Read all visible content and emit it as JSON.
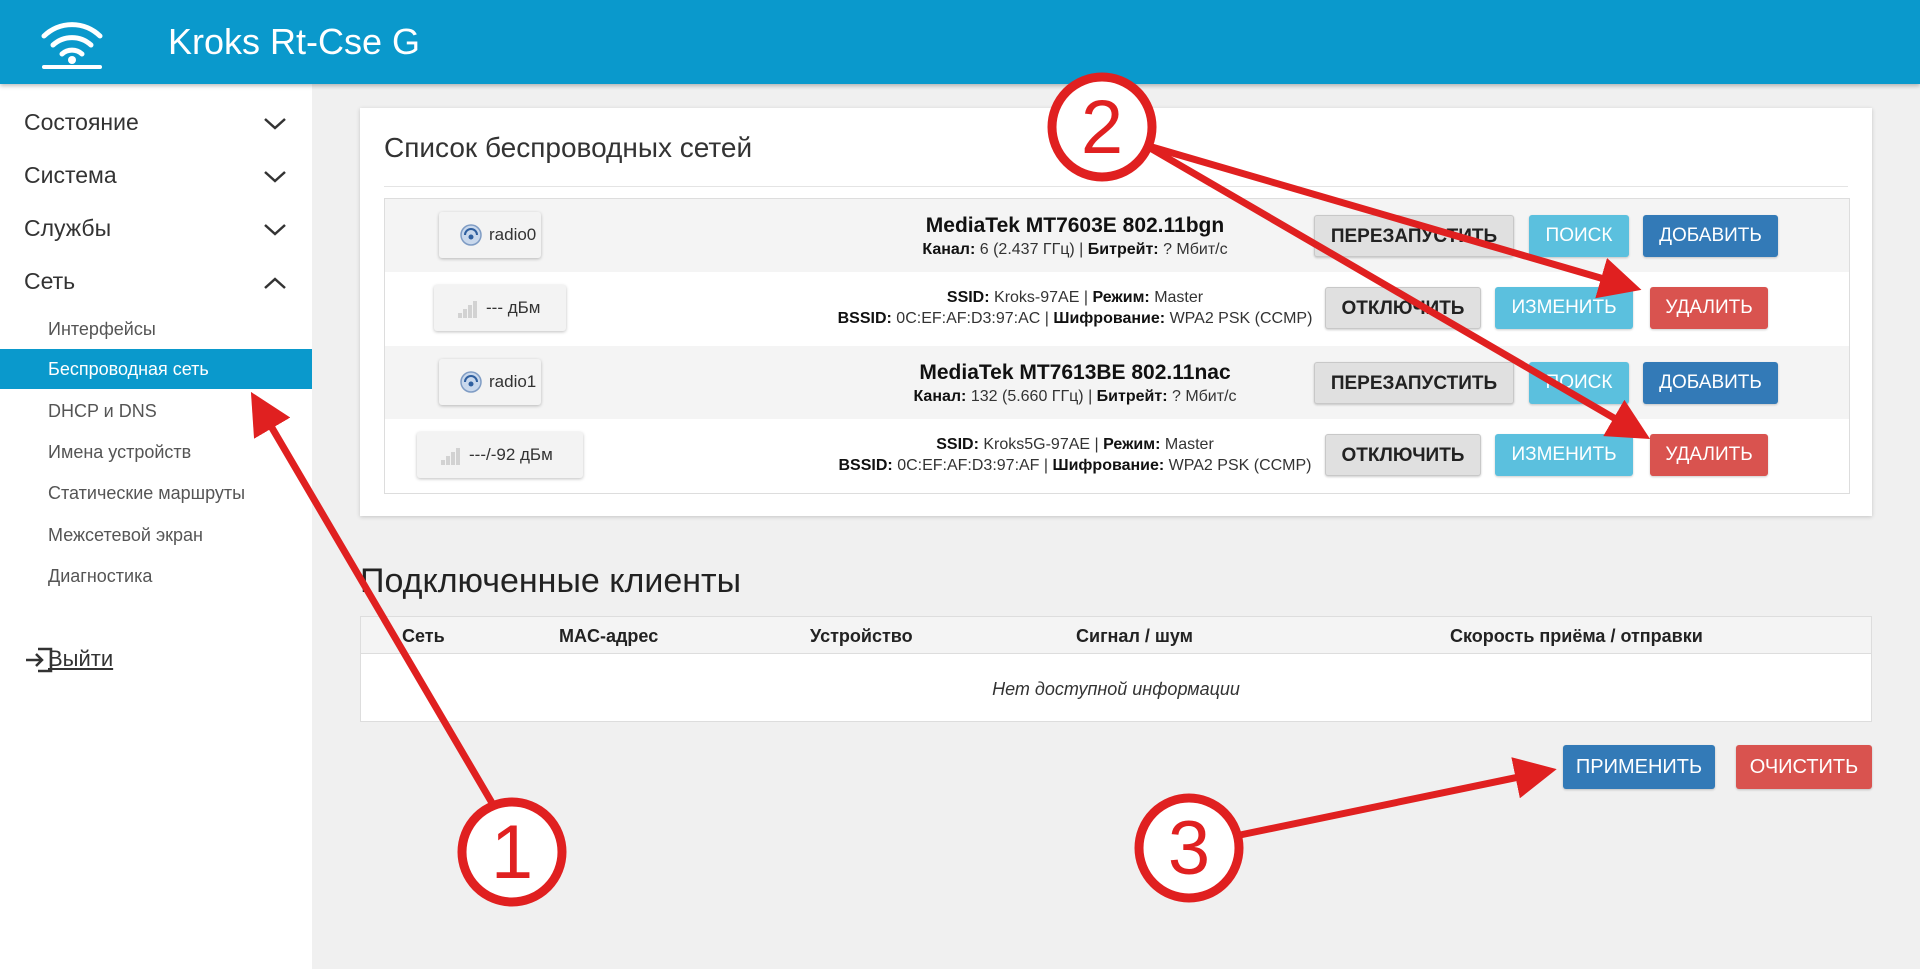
{
  "header": {
    "title": "Kroks Rt-Cse G"
  },
  "sidebar": {
    "items": [
      {
        "label": "Состояние",
        "expanded": false
      },
      {
        "label": "Система",
        "expanded": false
      },
      {
        "label": "Службы",
        "expanded": false
      },
      {
        "label": "Сеть",
        "expanded": true
      }
    ],
    "subitems": [
      {
        "label": "Интерфейсы",
        "active": false
      },
      {
        "label": "Беспроводная сеть",
        "active": true
      },
      {
        "label": "DHCP и DNS",
        "active": false
      },
      {
        "label": "Имена устройств",
        "active": false
      },
      {
        "label": "Статические маршруты",
        "active": false
      },
      {
        "label": "Межсетевой экран",
        "active": false
      },
      {
        "label": "Диагностика",
        "active": false
      }
    ],
    "logout_label": "Выйти"
  },
  "wireless": {
    "title": "Список беспроводных сетей",
    "devices": [
      {
        "radio": "radio0",
        "name": "MediaTek MT7603E 802.11bgn",
        "channel_label": "Канал:",
        "channel_value": "6 (2.437 ГГц)",
        "bitrate_label": "Битрейт:",
        "bitrate_value": "? Мбит/с",
        "buttons": {
          "restart": "ПЕРЕЗАПУСТИТЬ",
          "scan": "ПОИСК",
          "add": "ДОБАВИТЬ"
        },
        "network": {
          "signal": "--- дБм",
          "ssid_label": "SSID:",
          "ssid": "Kroks-97AE",
          "mode_label": "Режим:",
          "mode": "Master",
          "bssid_label": "BSSID:",
          "bssid": "0C:EF:AF:D3:97:AC",
          "enc_label": "Шифрование:",
          "encryption": "WPA2 PSK (CCMP)",
          "buttons": {
            "disable": "ОТКЛЮЧИТЬ",
            "edit": "ИЗМЕНИТЬ",
            "delete": "УДАЛИТЬ"
          }
        }
      },
      {
        "radio": "radio1",
        "name": "MediaTek MT7613BE 802.11nac",
        "channel_label": "Канал:",
        "channel_value": "132 (5.660 ГГц)",
        "bitrate_label": "Битрейт:",
        "bitrate_value": "? Мбит/с",
        "buttons": {
          "restart": "ПЕРЕЗАПУСТИТЬ",
          "scan": "ПОИСК",
          "add": "ДОБАВИТЬ"
        },
        "network": {
          "signal": "---/-92 дБм",
          "ssid_label": "SSID:",
          "ssid": "Kroks5G-97AE",
          "mode_label": "Режим:",
          "mode": "Master",
          "bssid_label": "BSSID:",
          "bssid": "0C:EF:AF:D3:97:AF",
          "enc_label": "Шифрование:",
          "encryption": "WPA2 PSK (CCMP)",
          "buttons": {
            "disable": "ОТКЛЮЧИТЬ",
            "edit": "ИЗМЕНИТЬ",
            "delete": "УДАЛИТЬ"
          }
        }
      }
    ]
  },
  "clients": {
    "title": "Подключенные клиенты",
    "columns": [
      "Сеть",
      "MAC-адрес",
      "Устройство",
      "Сигнал / шум",
      "Скорость приёма / отправки"
    ],
    "empty_text": "Нет доступной информации"
  },
  "actions": {
    "apply": "ПРИМЕНИТЬ",
    "reset": "ОЧИСТИТЬ"
  },
  "annotations": {
    "markers": [
      "1",
      "2",
      "3"
    ],
    "color": "#e02020"
  },
  "colors": {
    "brand": "#0a99cc",
    "primary": "#337ab7",
    "info": "#5bc0de",
    "danger": "#d9534f"
  },
  "icons": {
    "logo": "wifi-router-icon",
    "radio": "wireless-radio-icon",
    "signal": "signal-bars-icon",
    "logout": "logout-icon"
  }
}
